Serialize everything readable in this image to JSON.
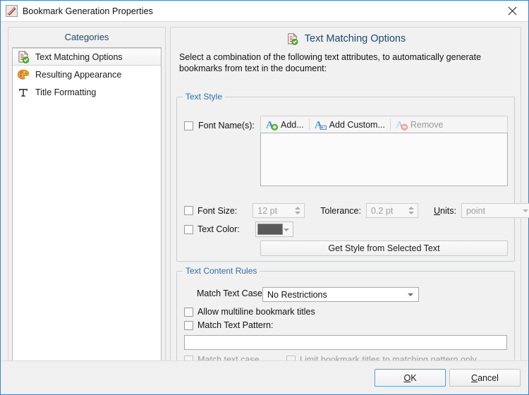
{
  "window": {
    "title": "Bookmark Generation Properties",
    "icon": "app-pdf-icon",
    "close_label": "Close"
  },
  "sidebar": {
    "header": "Categories",
    "items": [
      {
        "label": "Text Matching Options",
        "icon": "document-check-icon",
        "selected": true
      },
      {
        "label": "Resulting Appearance",
        "icon": "palette-icon",
        "selected": false
      },
      {
        "label": "Title Formatting",
        "icon": "text-t-icon",
        "selected": false
      }
    ]
  },
  "pane": {
    "title": "Text Matching Options",
    "icon": "document-check-icon",
    "description": "Select a combination of the following text attributes, to automatically generate bookmarks from text in the document:"
  },
  "text_style": {
    "group_label": "Text Style",
    "font_names": {
      "checkbox_label": "Font Name(s):",
      "checked": false,
      "toolbar": [
        {
          "label": "Add...",
          "icon": "add-font-icon",
          "enabled": true
        },
        {
          "label": "Add Custom...",
          "icon": "add-custom-font-icon",
          "enabled": true
        },
        {
          "label": "Remove",
          "icon": "remove-font-icon",
          "enabled": false
        }
      ],
      "list_items": []
    },
    "font_size": {
      "checkbox_label": "Font Size:",
      "checked": false,
      "value": "12 pt",
      "tolerance_label": "Tolerance:",
      "tolerance_value": "0.2 pt",
      "units_label": "Units:",
      "units_accel": "U",
      "units_value": "point"
    },
    "text_color": {
      "checkbox_label": "Text Color:",
      "checked": false,
      "swatch_color": "#5a5a5a"
    },
    "get_style_button": "Get Style from Selected Text"
  },
  "content_rules": {
    "group_label": "Text Content Rules",
    "match_text_case": {
      "label": "Match Text Case:",
      "value": "No Restrictions"
    },
    "allow_multiline": {
      "label": "Allow multiline bookmark titles",
      "checked": false
    },
    "match_text_pattern": {
      "label": "Match Text Pattern:",
      "checked": false,
      "input_value": ""
    },
    "match_text_case_cb": {
      "label": "Match text case",
      "checked": false,
      "enabled": false
    },
    "limit_titles": {
      "label": "Limit bookmark titles to matching pattern only",
      "checked": false,
      "enabled": false
    }
  },
  "footer": {
    "ok": {
      "prefix": "",
      "accel": "O",
      "suffix": "K"
    },
    "cancel": {
      "prefix": "",
      "accel": "C",
      "suffix": "ancel"
    }
  }
}
